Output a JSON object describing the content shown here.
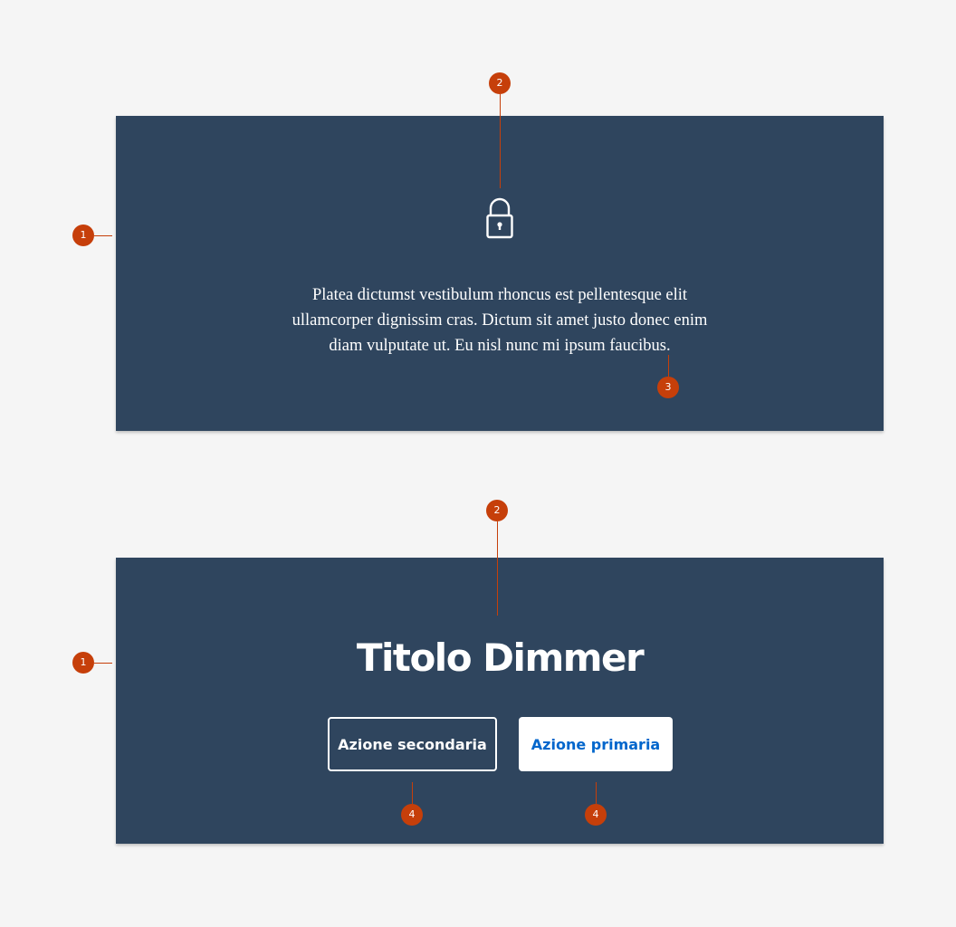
{
  "colors": {
    "background": "#f5f5f5",
    "dimmer": "#2f455e",
    "marker": "#c63f0a",
    "primary_text": "#0066cc"
  },
  "dimmer_icon": {
    "icon": "lock-icon",
    "text": "Platea dictumst vestibulum rhoncus est pellentesque elit ullamcorper dignissim cras. Dictum sit amet justo donec enim diam vulputate ut. Eu nisl nunc mi ipsum faucibus."
  },
  "dimmer_actions": {
    "title": "Titolo Dimmer",
    "secondary_label": "Azione secondaria",
    "primary_label": "Azione primaria"
  },
  "annotations": {
    "container": "1",
    "header": "2",
    "text": "3",
    "action": "4"
  }
}
